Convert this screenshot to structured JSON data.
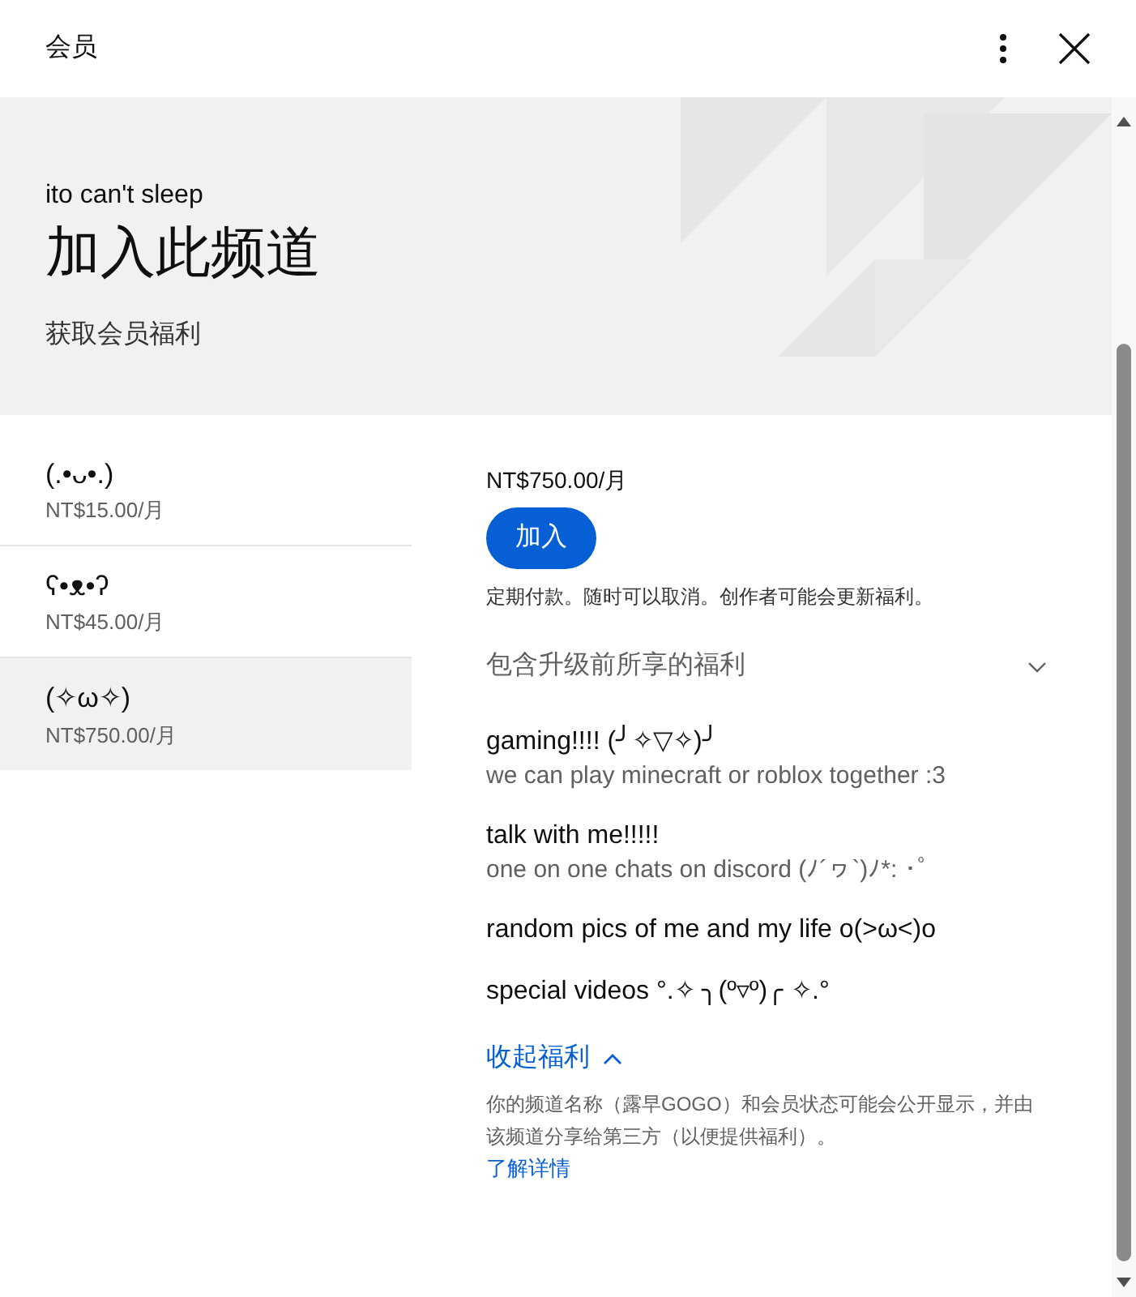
{
  "header": {
    "title": "会员"
  },
  "banner": {
    "channel": "ito can't sleep",
    "title": "加入此频道",
    "subtitle": "获取会员福利"
  },
  "tiers": [
    {
      "name": "(.•ᴗ•.)",
      "price": "NT$15.00/月",
      "selected": false
    },
    {
      "name": "ʕ•ᴥ•ʔ",
      "price": "NT$45.00/月",
      "selected": false
    },
    {
      "name": "(✧ω✧)",
      "price": "NT$750.00/月",
      "selected": true
    }
  ],
  "detail": {
    "price": "NT$750.00/月",
    "join_button": "加入",
    "note": "定期付款。随时可以取消。创作者可能会更新福利。",
    "previous_perks": "包含升级前所享的福利",
    "perks": [
      {
        "title": "gaming!!!! (╯✧▽✧)╯",
        "description": "we can play minecraft or roblox together :3"
      },
      {
        "title": "talk with me!!!!!",
        "description": "one on one chats on discord (ﾉ´ヮ`)ﾉ*: ･ﾟ"
      },
      {
        "title": "random pics of me and my life o(>ω<)o"
      },
      {
        "title": "special videos °.✧ ╮(º▿º)╭ ✧.°"
      }
    ],
    "collapse_link": "收起福利",
    "disclaimer": "你的频道名称（露早GOGO）和会员状态可能会公开显示，并由该频道分享给第三方（以便提供福利）。",
    "learn_more": "了解详情"
  }
}
